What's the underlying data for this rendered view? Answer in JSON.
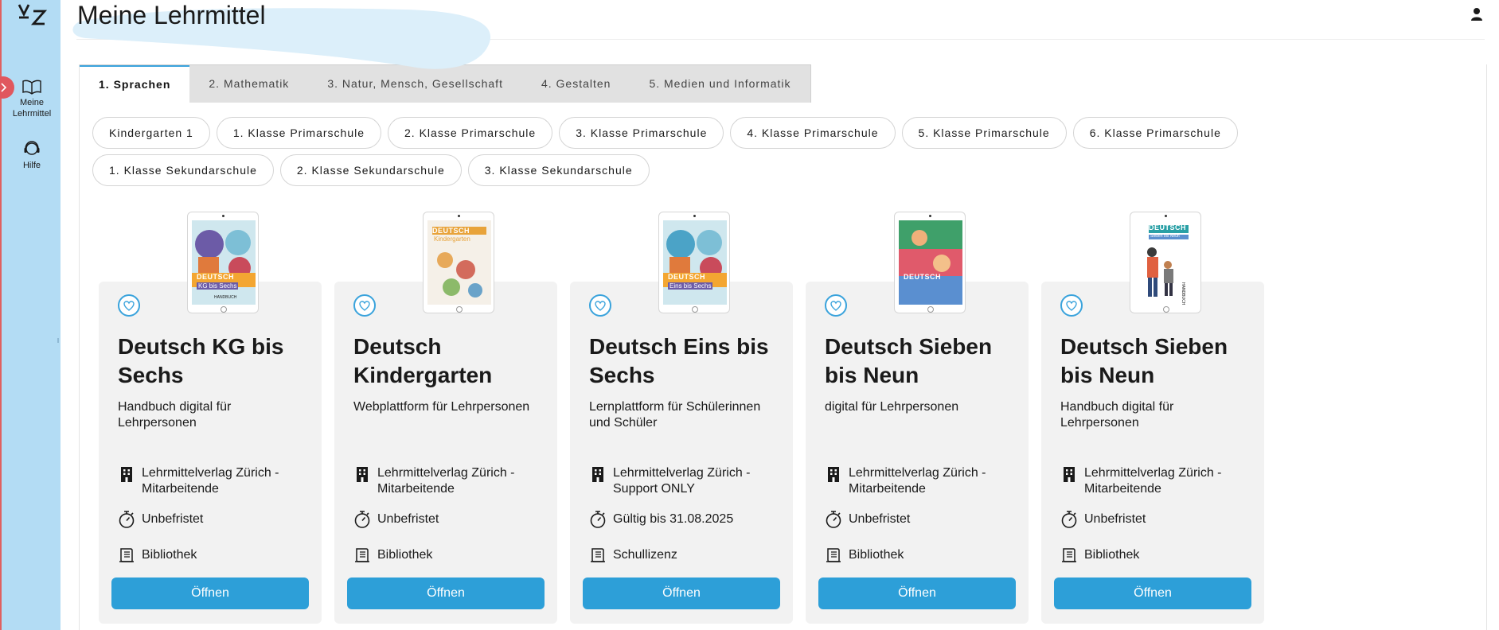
{
  "app": {
    "logo_text": "VZ"
  },
  "header": {
    "title": "Meine Lehrmittel"
  },
  "sidebar": {
    "items": [
      {
        "label": "Meine\nLehrmittel",
        "icon": "book-open-icon"
      },
      {
        "label": "Hilfe",
        "icon": "headset-icon"
      }
    ]
  },
  "tabs": [
    {
      "label": "1. Sprachen",
      "active": true
    },
    {
      "label": "2. Mathematik",
      "active": false
    },
    {
      "label": "3. Natur, Mensch, Gesellschaft",
      "active": false
    },
    {
      "label": "4. Gestalten",
      "active": false
    },
    {
      "label": "5. Medien und Informatik",
      "active": false
    }
  ],
  "levels": [
    "Kindergarten 1",
    "1. Klasse Primarschule",
    "2. Klasse Primarschule",
    "3. Klasse Primarschule",
    "4. Klasse Primarschule",
    "5. Klasse Primarschule",
    "6. Klasse Primarschule",
    "1. Klasse Sekundarschule",
    "2. Klasse Sekundarschule",
    "3. Klasse Sekundarschule"
  ],
  "cards": [
    {
      "title": "Deutsch KG bis Sechs",
      "subtitle": "Handbuch digital für Lehrpersonen",
      "organisation": "Lehrmittelverlag Zürich - Mitarbeitende",
      "duration": "Unbefristet",
      "license": "Bibliothek",
      "button": "Öffnen",
      "cover": {
        "brand": "DEUTSCH",
        "caption": "KG bis Sechs",
        "tag": "HANDBUCH",
        "bg": "#f3a632",
        "accent": "#6c5ba7"
      }
    },
    {
      "title": "Deutsch Kindergarten",
      "subtitle": "Webplattform für Lehrpersonen",
      "organisation": "Lehrmittelverlag Zürich - Mitarbeitende",
      "duration": "Unbefristet",
      "license": "Bibliothek",
      "button": "Öffnen",
      "cover": {
        "brand": "DEUTSCH",
        "caption": "Kindergarten",
        "tag": "",
        "bg": "#f5f0e8",
        "accent": "#e8a33a"
      }
    },
    {
      "title": "Deutsch Eins bis Sechs",
      "subtitle": "Lernplattform für Schülerinnen und Schüler",
      "organisation": "Lehrmittelverlag Zürich - Support ONLY",
      "duration": "Gültig bis 31.08.2025",
      "license": "Schullizenz",
      "button": "Öffnen",
      "cover": {
        "brand": "DEUTSCH",
        "caption": "Eins bis Sechs",
        "tag": "",
        "bg": "#f3a632",
        "accent": "#4ba3c7"
      }
    },
    {
      "title": "Deutsch Sieben bis Neun",
      "subtitle": "digital für Lehrpersonen",
      "organisation": "Lehrmittelverlag Zürich - Mitarbeitende",
      "duration": "Unbefristet",
      "license": "Bibliothek",
      "button": "Öffnen",
      "cover": {
        "brand": "DEUTSCH",
        "caption": "",
        "tag": "",
        "bg": "#3fa06a",
        "accent": "#e05a6b"
      }
    },
    {
      "title": "Deutsch Sieben bis Neun",
      "subtitle": "Handbuch digital für Lehrpersonen",
      "organisation": "Lehrmittelverlag Zürich - Mitarbeitende",
      "duration": "Unbefristet",
      "license": "Bibliothek",
      "button": "Öffnen",
      "cover": {
        "brand": "DEUTSCH",
        "caption": "Sieben bis Neun",
        "tag": "HANDBUCH",
        "bg": "#ffffff",
        "accent": "#2aa0a6"
      }
    }
  ],
  "colors": {
    "sidebar_bg": "#b3dcf4",
    "accent_blue": "#2d9fd8",
    "collapse_red": "#e0575e",
    "card_bg": "#f2f2f2"
  }
}
